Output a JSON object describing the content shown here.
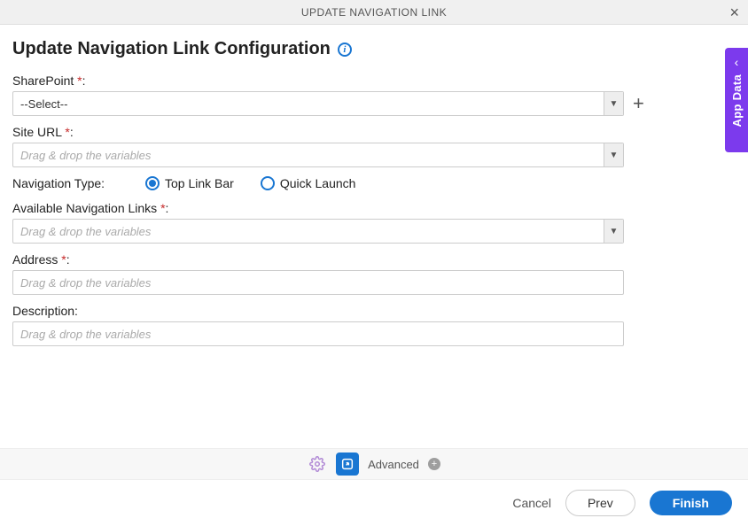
{
  "titlebar": {
    "title": "UPDATE NAVIGATION LINK"
  },
  "heading": "Update Navigation Link Configuration",
  "fields": {
    "sharepoint": {
      "label": "SharePoint",
      "required": "*",
      "colon": ":",
      "value": "--Select--"
    },
    "siteurl": {
      "label": "Site URL",
      "required": "*",
      "colon": ":",
      "placeholder": "Drag & drop the variables"
    },
    "navtype": {
      "label": "Navigation Type:",
      "options": {
        "toplink": "Top Link Bar",
        "quicklaunch": "Quick Launch"
      },
      "selected": "toplink"
    },
    "availlinks": {
      "label": "Available Navigation Links",
      "required": "*",
      "colon": ":",
      "placeholder": "Drag & drop the variables"
    },
    "address": {
      "label": "Address",
      "required": "*",
      "colon": ":",
      "placeholder": "Drag & drop the variables"
    },
    "description": {
      "label": "Description:",
      "placeholder": "Drag & drop the variables"
    }
  },
  "toolbar": {
    "advanced": "Advanced"
  },
  "footer": {
    "cancel": "Cancel",
    "prev": "Prev",
    "finish": "Finish"
  },
  "sidetab": {
    "label": "App Data"
  }
}
